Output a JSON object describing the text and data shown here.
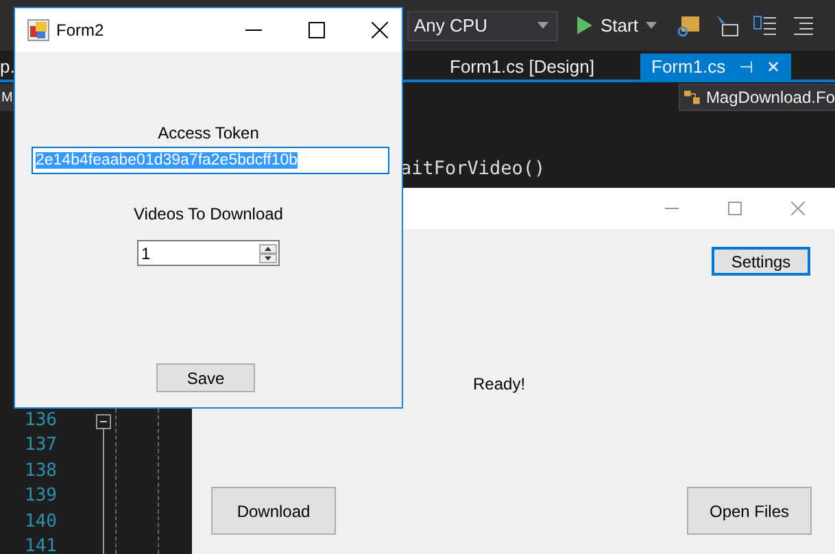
{
  "ide": {
    "platform": "Any CPU",
    "start_label": "Start",
    "tabs": [
      {
        "label": "Form1.cs [Design]",
        "selected": false
      },
      {
        "label": "Form1.cs",
        "selected": true
      }
    ],
    "pin_glyph": "⊣",
    "close_glyph": "✕",
    "left_fragments": [
      "p.",
      "M"
    ],
    "nav_right": "MagDownload.Fo",
    "code_fragment": "aitForVideo()",
    "line_numbers": [
      "136",
      "137",
      "138",
      "139",
      "140",
      "141"
    ]
  },
  "form1": {
    "status": "Ready!",
    "buttons": {
      "settings": "Settings",
      "download": "Download",
      "open": "Open Files"
    }
  },
  "form2": {
    "title": "Form2",
    "token_label": "Access Token",
    "token_value": "2e14b4feaabe01d39a7fa2e5bdcff10b",
    "token_selected": true,
    "videos_label": "Videos To Download",
    "videos_value": "1",
    "save": "Save"
  }
}
